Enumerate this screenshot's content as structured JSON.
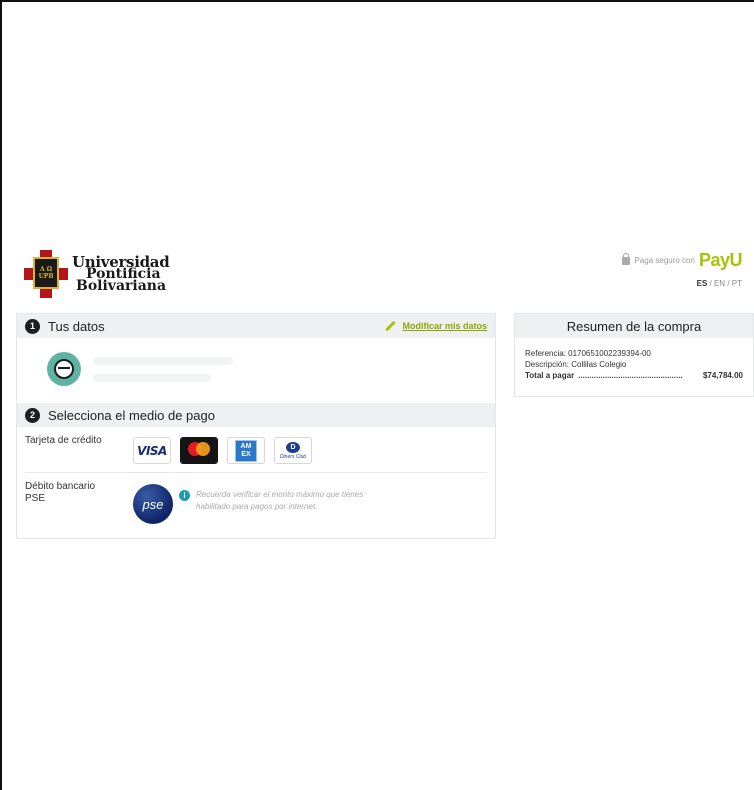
{
  "header": {
    "logo": {
      "line1": "Universidad",
      "line2": "Pontificia",
      "line3": "Bolivariana",
      "crest_text": [
        "A Ω",
        "UPB"
      ]
    },
    "payu": {
      "secure_text": "Paga seguro con",
      "brand": "PayU",
      "lang_es": "ES",
      "lang_sep1": " / ",
      "lang_en": "EN",
      "lang_sep2": " / ",
      "lang_pt": "PT"
    }
  },
  "datos": {
    "step": "1",
    "title": "Tus datos",
    "modify_label": "Modificar mis datos"
  },
  "pago": {
    "step": "2",
    "title": "Selecciona el medio de pago",
    "credit_label": "Tarjeta de crédito",
    "cards": {
      "visa": "VISA",
      "amex_top": "AM",
      "amex_bottom": "EX",
      "diners_mark": "D",
      "diners_text": "Diners Club"
    },
    "debit_label_1": "Débito bancario",
    "debit_label_2": "PSE",
    "pse_text": "pse",
    "info_text": "Recuerda verificar el monto máximo que tienes habilitado para pagos por internet."
  },
  "resumen": {
    "title": "Resumen de la compra",
    "referencia": "Referencia: 0170651002239394-00",
    "descripcion": "Descripción: Collilas Colegio",
    "total_label": "Total a pagar",
    "total_dots": "...............................................",
    "total_value": "$74,784.00"
  },
  "colors": {
    "accent_green": "#a6c307",
    "section_bg": "#eef0f1",
    "pse_blue": "#0d2466",
    "info_blue": "#1e9ab8"
  }
}
